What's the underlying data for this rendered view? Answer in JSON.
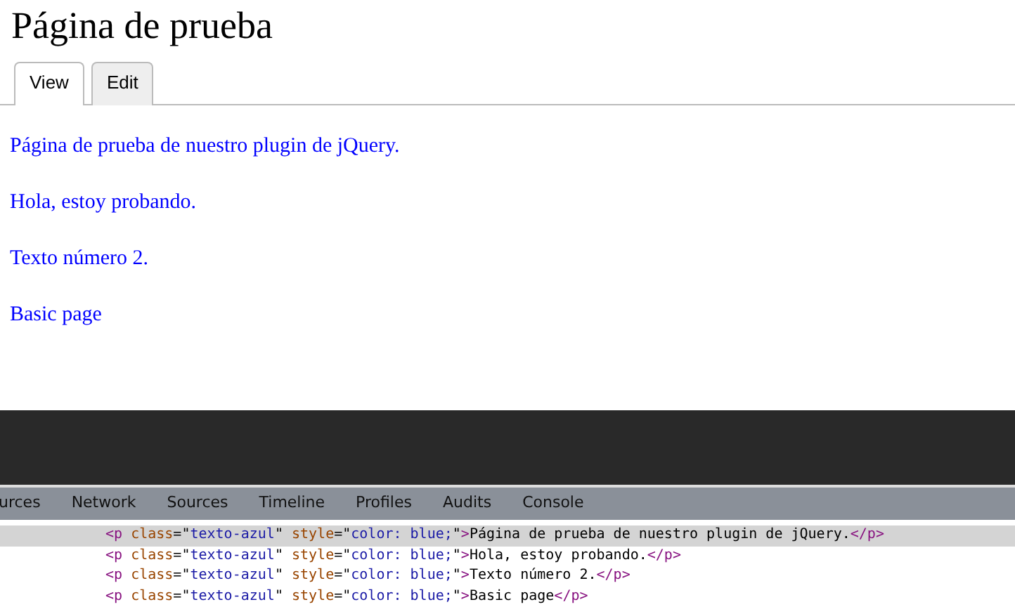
{
  "page": {
    "title": "Página de prueba",
    "tabs": [
      {
        "label": "View",
        "selected": true
      },
      {
        "label": "Edit",
        "selected": false
      }
    ],
    "paragraphs": [
      "Página de prueba de nuestro plugin de jQuery.",
      "Hola, estoy probando.",
      "Texto número 2.",
      "Basic page"
    ]
  },
  "devtools": {
    "tabs": [
      "urces",
      "Network",
      "Sources",
      "Timeline",
      "Profiles",
      "Audits",
      "Console"
    ],
    "code_lines": [
      {
        "selected": true,
        "tokens": [
          {
            "kind": "tag",
            "text": "<p"
          },
          {
            "kind": "attr",
            "text": " class"
          },
          {
            "kind": "punct",
            "text": "=\""
          },
          {
            "kind": "value",
            "text": "texto-azul"
          },
          {
            "kind": "punct",
            "text": "\""
          },
          {
            "kind": "attr",
            "text": " style"
          },
          {
            "kind": "punct",
            "text": "=\""
          },
          {
            "kind": "value",
            "text": "color: blue;"
          },
          {
            "kind": "punct",
            "text": "\""
          },
          {
            "kind": "tag",
            "text": ">"
          },
          {
            "kind": "text",
            "text": "Página de prueba de nuestro plugin de jQuery."
          },
          {
            "kind": "tag",
            "text": "</p>"
          }
        ]
      },
      {
        "selected": false,
        "tokens": [
          {
            "kind": "tag",
            "text": "<p"
          },
          {
            "kind": "attr",
            "text": " class"
          },
          {
            "kind": "punct",
            "text": "=\""
          },
          {
            "kind": "value",
            "text": "texto-azul"
          },
          {
            "kind": "punct",
            "text": "\""
          },
          {
            "kind": "attr",
            "text": " style"
          },
          {
            "kind": "punct",
            "text": "=\""
          },
          {
            "kind": "value",
            "text": "color: blue;"
          },
          {
            "kind": "punct",
            "text": "\""
          },
          {
            "kind": "tag",
            "text": ">"
          },
          {
            "kind": "text",
            "text": "Hola, estoy probando."
          },
          {
            "kind": "tag",
            "text": "</p>"
          }
        ]
      },
      {
        "selected": false,
        "tokens": [
          {
            "kind": "tag",
            "text": "<p"
          },
          {
            "kind": "attr",
            "text": " class"
          },
          {
            "kind": "punct",
            "text": "=\""
          },
          {
            "kind": "value",
            "text": "texto-azul"
          },
          {
            "kind": "punct",
            "text": "\""
          },
          {
            "kind": "attr",
            "text": " style"
          },
          {
            "kind": "punct",
            "text": "=\""
          },
          {
            "kind": "value",
            "text": "color: blue;"
          },
          {
            "kind": "punct",
            "text": "\""
          },
          {
            "kind": "tag",
            "text": ">"
          },
          {
            "kind": "text",
            "text": "Texto número 2."
          },
          {
            "kind": "tag",
            "text": "</p>"
          }
        ]
      },
      {
        "selected": false,
        "tokens": [
          {
            "kind": "tag",
            "text": "<p"
          },
          {
            "kind": "attr",
            "text": " class"
          },
          {
            "kind": "punct",
            "text": "=\""
          },
          {
            "kind": "value",
            "text": "texto-azul"
          },
          {
            "kind": "punct",
            "text": "\""
          },
          {
            "kind": "attr",
            "text": " style"
          },
          {
            "kind": "punct",
            "text": "=\""
          },
          {
            "kind": "value",
            "text": "color: blue;"
          },
          {
            "kind": "punct",
            "text": "\""
          },
          {
            "kind": "tag",
            "text": ">"
          },
          {
            "kind": "text",
            "text": "Basic page"
          },
          {
            "kind": "tag",
            "text": "</p>"
          }
        ]
      }
    ]
  }
}
